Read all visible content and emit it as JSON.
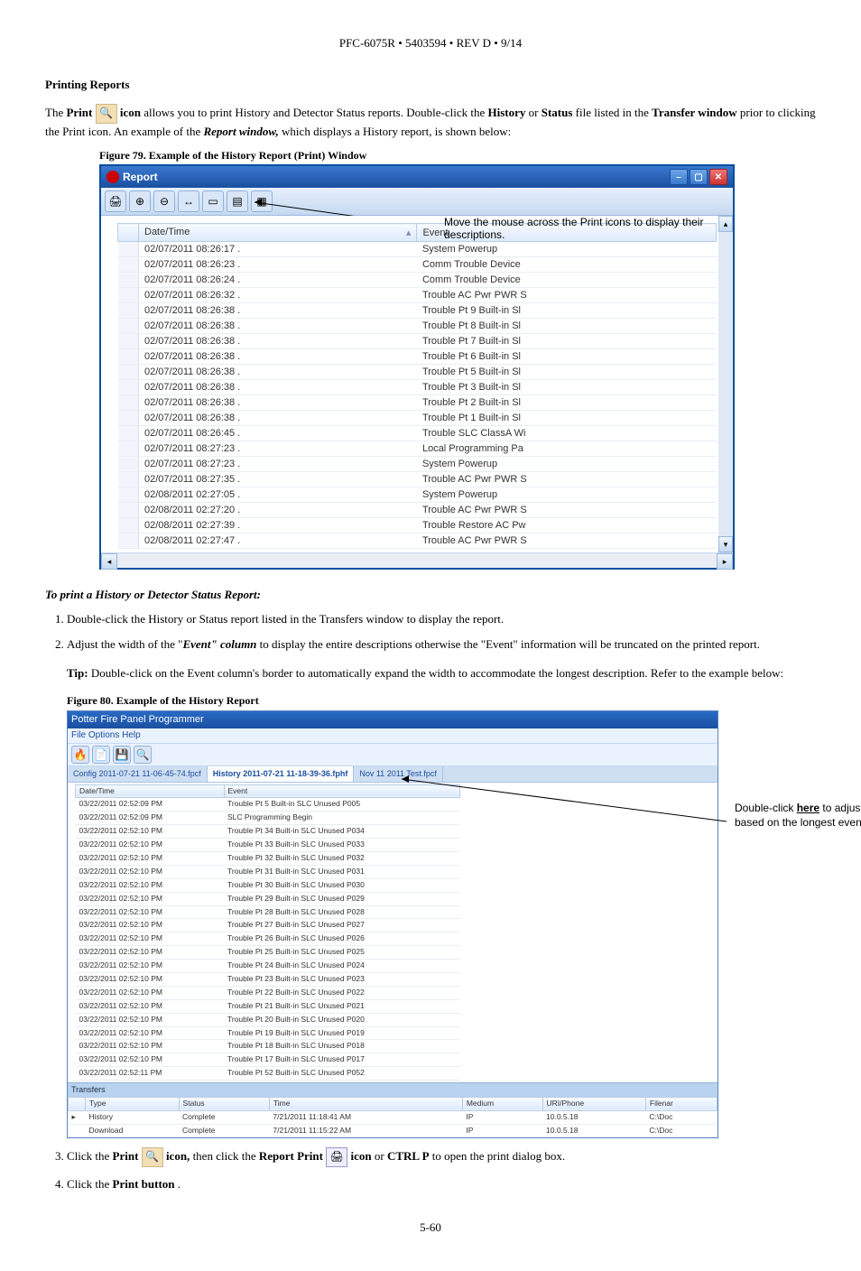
{
  "header": "PFC-6075R • 5403594 • REV D • 9/14",
  "section_title": "Printing Reports",
  "intro_parts": {
    "p1a": "The ",
    "p1b": "Print ",
    "p1c": " icon",
    "p1d": " allows you to print History and Detector Status reports. Double-click the ",
    "p1e": "History",
    "p1f": " or ",
    "p1g": "Status",
    "p1h": " file listed in the ",
    "p1i": "Transfer window",
    "p1j": " prior to clicking the Print icon. An example of the ",
    "p1k": "Report window,",
    "p1l": " which displays a History report, is shown below:"
  },
  "fig79_caption": "Figure 79.  Example of the History Report (Print) Window",
  "report_window": {
    "title": "Report",
    "annotation": "Move the mouse across the Print icons to display their descriptions.",
    "columns": {
      "date": "Date/Time",
      "event": "Event"
    },
    "rows": [
      {
        "dt": "02/07/2011 08:26:17 .",
        "ev": "System Powerup"
      },
      {
        "dt": "02/07/2011 08:26:23 .",
        "ev": "Comm Trouble Device"
      },
      {
        "dt": "02/07/2011 08:26:24 .",
        "ev": "Comm Trouble Device"
      },
      {
        "dt": "02/07/2011 08:26:32 .",
        "ev": "Trouble AC Pwr PWR S"
      },
      {
        "dt": "02/07/2011 08:26:38 .",
        "ev": "Trouble Pt 9 Built-in Sl"
      },
      {
        "dt": "02/07/2011 08:26:38 .",
        "ev": "Trouble Pt 8 Built-in Sl"
      },
      {
        "dt": "02/07/2011 08:26:38 .",
        "ev": "Trouble Pt 7 Built-in Sl"
      },
      {
        "dt": "02/07/2011 08:26:38 .",
        "ev": "Trouble Pt 6 Built-in Sl"
      },
      {
        "dt": "02/07/2011 08:26:38 .",
        "ev": "Trouble Pt 5 Built-in Sl"
      },
      {
        "dt": "02/07/2011 08:26:38 .",
        "ev": "Trouble Pt 3 Built-in Sl"
      },
      {
        "dt": "02/07/2011 08:26:38 .",
        "ev": "Trouble Pt 2 Built-in Sl"
      },
      {
        "dt": "02/07/2011 08:26:38 .",
        "ev": "Trouble Pt 1 Built-in Sl"
      },
      {
        "dt": "02/07/2011 08:26:45 .",
        "ev": "Trouble SLC ClassA Wi"
      },
      {
        "dt": "02/07/2011 08:27:23 .",
        "ev": "Local Programming Pa"
      },
      {
        "dt": "02/07/2011 08:27:23 .",
        "ev": "System Powerup"
      },
      {
        "dt": "02/07/2011 08:27:35 .",
        "ev": "Trouble AC Pwr PWR S"
      },
      {
        "dt": "02/08/2011 02:27:05 .",
        "ev": "System Powerup"
      },
      {
        "dt": "02/08/2011 02:27:20 .",
        "ev": "Trouble AC Pwr PWR S"
      },
      {
        "dt": "02/08/2011 02:27:39 .",
        "ev": "Trouble Restore AC Pw"
      },
      {
        "dt": "02/08/2011 02:27:47 .",
        "ev": "Trouble AC Pwr PWR S"
      }
    ]
  },
  "instr_title": "To print a History or Detector Status Report:",
  "steps": {
    "s1": "Double-click the History or Status report listed in the Transfers window to display the report.",
    "s2a": "Adjust the width of the \"",
    "s2b": "Event\" column",
    "s2c": " to display the entire descriptions otherwise the \"Event\" information will be truncated on the printed report.",
    "tip_label": "Tip:",
    "tip_text": " Double-click on the Event column's border to automatically expand the width to accommodate the longest description. Refer to the example below:",
    "s3a": "Click the ",
    "s3b": "Print ",
    "s3c": " icon,",
    "s3d": " then click the ",
    "s3e": "Report Print ",
    "s3f": " icon",
    "s3g": " or ",
    "s3h": "CTRL P",
    "s3i": " to open the print dialog box.",
    "s4a": "Click the ",
    "s4b": "Print button",
    "s4c": "."
  },
  "fig80_caption": "Figure 80.  Example of the History Report",
  "programmer_window": {
    "title": "Potter Fire Panel Programmer",
    "menu": "File   Options   Help",
    "tabs": [
      "Config 2011-07-21 11-06-45-74.fpcf",
      "History 2011-07-21 11-18-39-36.fphf",
      "Nov 11 2011 Test.fpcf"
    ],
    "columns": {
      "date": "Date/Time",
      "event": "Event"
    },
    "rows": [
      {
        "dt": "03/22/2011 02:52:09 PM",
        "ev": "Trouble Pt 5 Built-in SLC Unused P005"
      },
      {
        "dt": "03/22/2011 02:52:09 PM",
        "ev": "SLC Programming Begin"
      },
      {
        "dt": "03/22/2011 02:52:10 PM",
        "ev": "Trouble Pt 34 Built-in SLC Unused P034"
      },
      {
        "dt": "03/22/2011 02:52:10 PM",
        "ev": "Trouble Pt 33 Built-in SLC Unused P033"
      },
      {
        "dt": "03/22/2011 02:52:10 PM",
        "ev": "Trouble Pt 32 Built-in SLC Unused P032"
      },
      {
        "dt": "03/22/2011 02:52:10 PM",
        "ev": "Trouble Pt 31 Built-in SLC Unused P031"
      },
      {
        "dt": "03/22/2011 02:52:10 PM",
        "ev": "Trouble Pt 30 Built-in SLC Unused P030"
      },
      {
        "dt": "03/22/2011 02:52:10 PM",
        "ev": "Trouble Pt 29 Built-in SLC Unused P029"
      },
      {
        "dt": "03/22/2011 02:52:10 PM",
        "ev": "Trouble Pt 28 Built-in SLC Unused P028"
      },
      {
        "dt": "03/22/2011 02:52:10 PM",
        "ev": "Trouble Pt 27 Built-in SLC Unused P027"
      },
      {
        "dt": "03/22/2011 02:52:10 PM",
        "ev": "Trouble Pt 26 Built-in SLC Unused P026"
      },
      {
        "dt": "03/22/2011 02:52:10 PM",
        "ev": "Trouble Pt 25 Built-in SLC Unused P025"
      },
      {
        "dt": "03/22/2011 02:52:10 PM",
        "ev": "Trouble Pt 24 Built-in SLC Unused P024"
      },
      {
        "dt": "03/22/2011 02:52:10 PM",
        "ev": "Trouble Pt 23 Built-in SLC Unused P023"
      },
      {
        "dt": "03/22/2011 02:52:10 PM",
        "ev": "Trouble Pt 22 Built-in SLC Unused P022"
      },
      {
        "dt": "03/22/2011 02:52:10 PM",
        "ev": "Trouble Pt 21 Built-in SLC Unused P021"
      },
      {
        "dt": "03/22/2011 02:52:10 PM",
        "ev": "Trouble Pt 20 Built-in SLC Unused P020"
      },
      {
        "dt": "03/22/2011 02:52:10 PM",
        "ev": "Trouble Pt 19 Built-in SLC Unused P019"
      },
      {
        "dt": "03/22/2011 02:52:10 PM",
        "ev": "Trouble Pt 18 Built-in SLC Unused P018"
      },
      {
        "dt": "03/22/2011 02:52:10 PM",
        "ev": "Trouble Pt 17 Built-in SLC Unused P017"
      },
      {
        "dt": "03/22/2011 02:52:11 PM",
        "ev": "Trouble Pt 52 Built-in SLC Unused P052"
      }
    ],
    "transfers_label": "Transfers",
    "transfer_cols": [
      "Type",
      "Status",
      "Time",
      "Medium",
      "URI/Phone",
      "Filenar"
    ],
    "transfer_rows": [
      {
        "c": [
          "History",
          "Complete",
          "7/21/2011 11:18:41 AM",
          "IP",
          "10.0.5.18",
          "C:\\Doc"
        ]
      },
      {
        "c": [
          "Download",
          "Complete",
          "7/21/2011 11:15:22 AM",
          "IP",
          "10.0.5.18",
          "C:\\Doc"
        ]
      }
    ],
    "annotation_l1": "Double-click ",
    "annotation_here": "here",
    "annotation_l1b": " to adjust the column width",
    "annotation_l2": "based on the longest event description."
  },
  "page_num": "5-60"
}
